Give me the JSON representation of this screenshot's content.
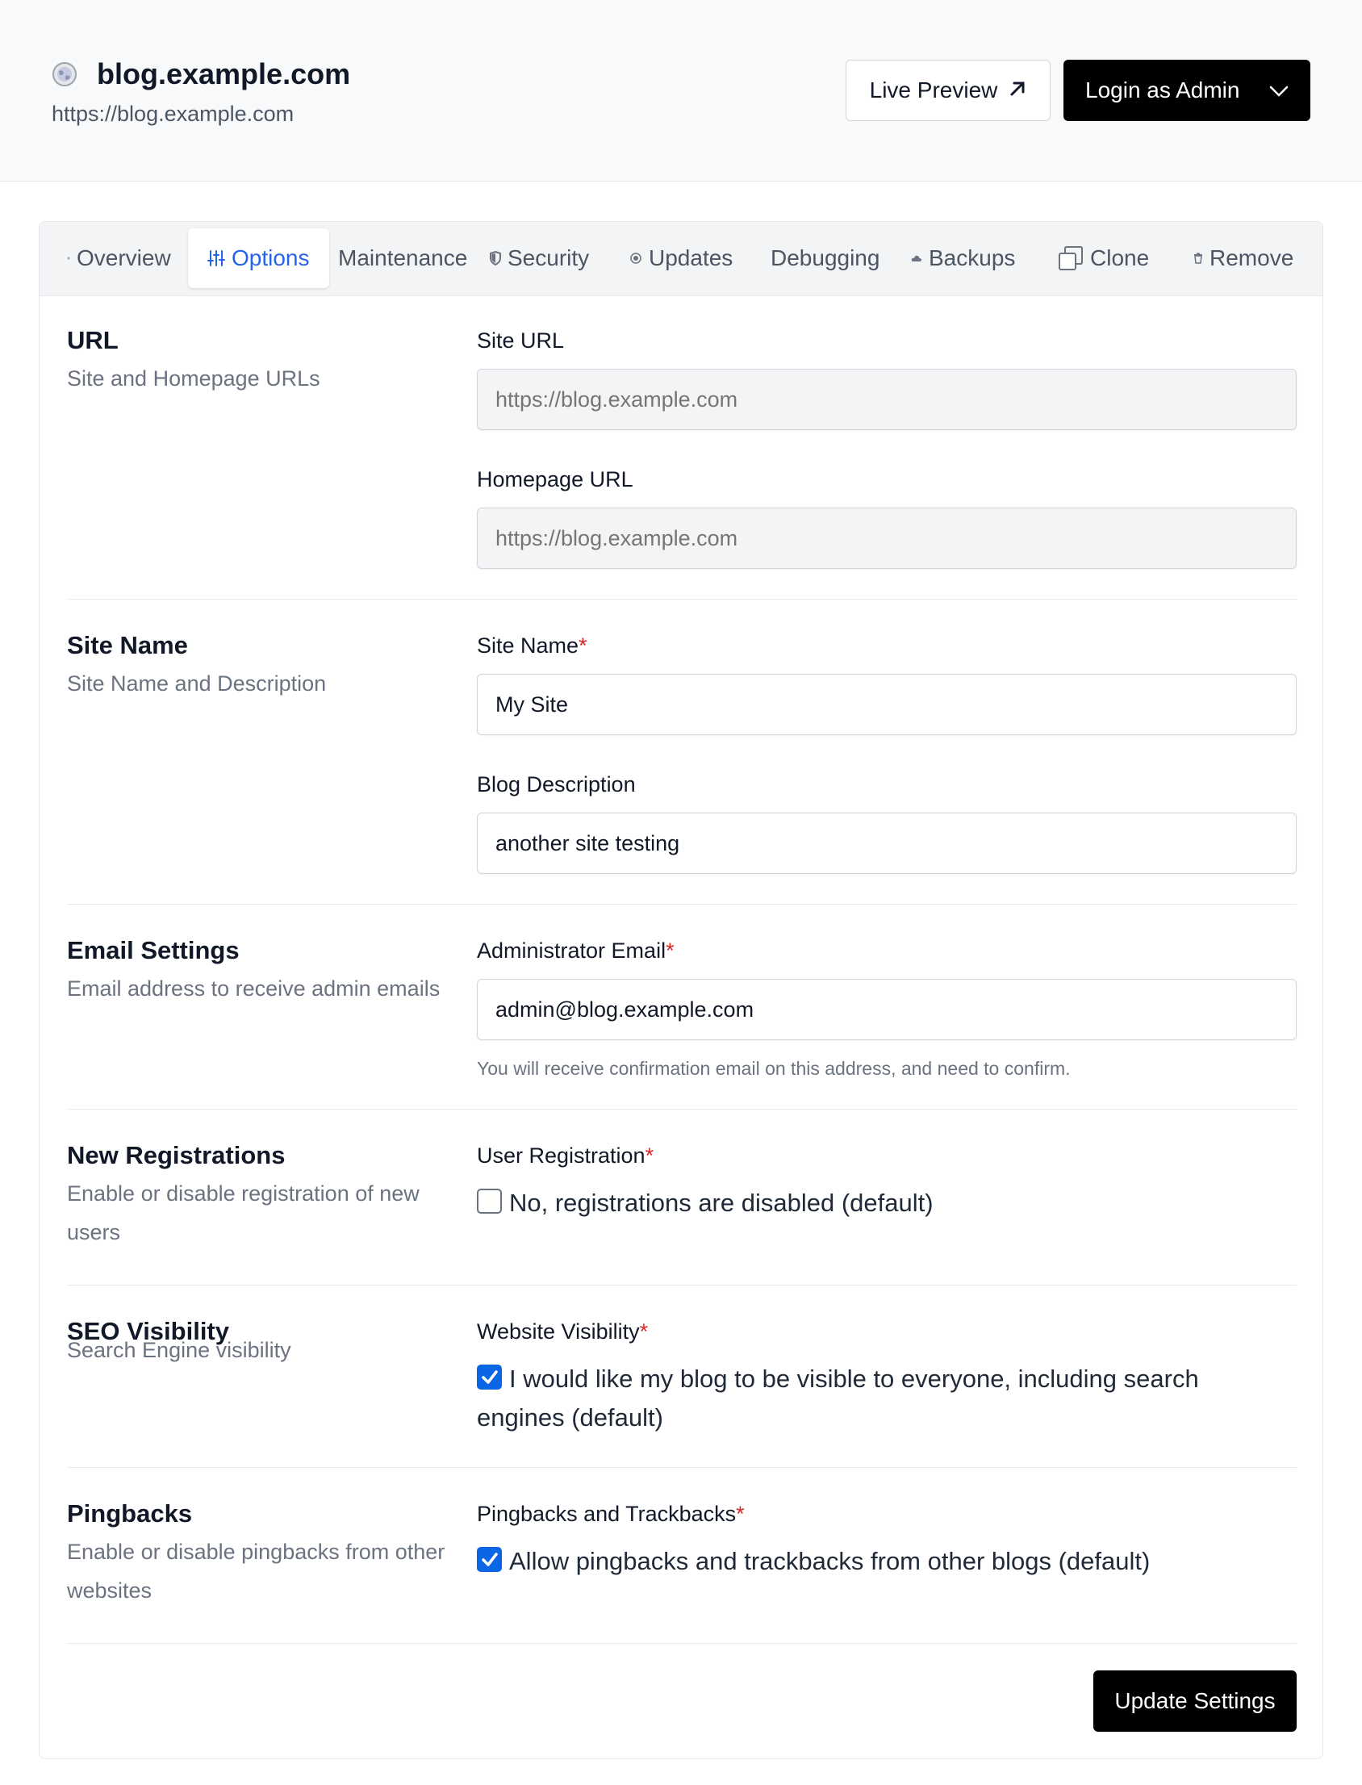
{
  "header": {
    "site_title": "blog.example.com",
    "site_url": "https://blog.example.com",
    "site_icon": "globe-icon",
    "preview_button": "Live Preview",
    "login_button": "Login as Admin"
  },
  "tabs": [
    {
      "label": "Overview",
      "icon": "dot-icon"
    },
    {
      "label": "Options",
      "icon": "sliders-icon",
      "active": true
    },
    {
      "label": "Maintenance",
      "icon": ""
    },
    {
      "label": "Security",
      "icon": "shield-icon"
    },
    {
      "label": "Updates",
      "icon": "radio-icon"
    },
    {
      "label": "Debugging",
      "icon": ""
    },
    {
      "label": "Backups",
      "icon": "cloud-icon"
    },
    {
      "label": "Clone",
      "icon": "copy-icon"
    },
    {
      "label": "Remove",
      "icon": "trash-icon"
    }
  ],
  "sections": {
    "url": {
      "title": "URL",
      "description": "Site and Homepage URLs",
      "site_url_label": "Site URL",
      "site_url_placeholder": "https://blog.example.com",
      "homepage_url_label": "Homepage URL",
      "homepage_url_placeholder": "https://blog.example.com"
    },
    "site_name": {
      "title": "Site Name",
      "description": "Site Name and Description",
      "name_label": "Site Name",
      "name_value": "My Site",
      "desc_label": "Blog Description",
      "desc_value": "another site testing"
    },
    "email": {
      "title": "Email Settings",
      "description": "Email address to receive admin emails",
      "label": "Administrator Email",
      "value": "admin@blog.example.com",
      "hint": "You will receive confirmation email on this address, and need to confirm."
    },
    "registrations": {
      "title": "New Registrations",
      "description": "Enable or disable registration of new users",
      "label": "User Registration",
      "checkbox_text": "No, registrations are disabled (default)",
      "checked": false
    },
    "seo": {
      "title": "SEO Visibility",
      "description": "Search Engine visibility",
      "label": "Website Visibility",
      "checkbox_text": "I would like my blog to be visible to everyone, including search engines (default)",
      "checked": true
    },
    "pingbacks": {
      "title": "Pingbacks",
      "description": "Enable or disable pingbacks from other websites",
      "label": "Pingbacks and Trackbacks",
      "checkbox_text": "Allow pingbacks and trackbacks from other blogs (default)",
      "checked": true
    }
  },
  "required_marker": "*",
  "update_button": "Update Settings",
  "colors": {
    "accent": "#2563eb",
    "checkbox": "#0a66e4",
    "required": "#dc2626",
    "primary_button": "#000000"
  }
}
